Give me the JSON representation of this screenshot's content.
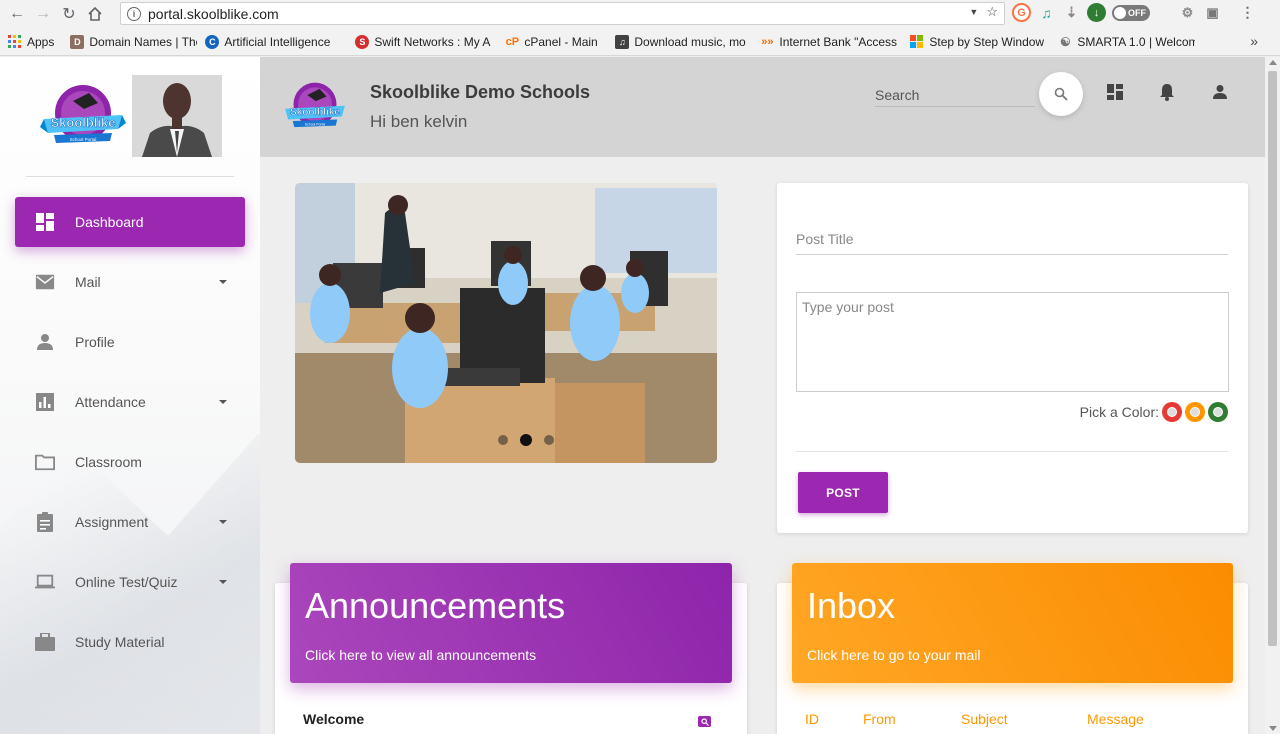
{
  "browser": {
    "url": "portal.skoolblike.com",
    "toggle_label": "OFF",
    "bookmarks": [
      {
        "label": "Apps",
        "icon": "apps-grid-icon",
        "color": "#4285f4"
      },
      {
        "label": "Domain Names | The",
        "icon": "domain-icon",
        "color": "#8d6e63"
      },
      {
        "label": "Artificial Intelligence",
        "icon": "ai-icon",
        "color": "#1565c0"
      },
      {
        "label": "Swift Networks : My A",
        "icon": "swift-icon",
        "color": "#d32f2f"
      },
      {
        "label": "cPanel - Main",
        "icon": "cpanel-icon",
        "color": "#ff6f00"
      },
      {
        "label": "Download music, mo",
        "icon": "download-music-icon",
        "color": "#424242"
      },
      {
        "label": "Internet Bank \"Access",
        "icon": "bank-icon",
        "color": "#ef6c00"
      },
      {
        "label": "Step by Step Window",
        "icon": "windows-icon",
        "color": "#43a047"
      },
      {
        "label": "SMARTA 1.0 | Welcom",
        "icon": "smarta-icon",
        "color": "#757575"
      }
    ]
  },
  "header": {
    "school_name": "Skoolblike Demo Schools",
    "greeting": "Hi ben kelvin",
    "search_placeholder": "Search"
  },
  "sidebar": {
    "logo_text": "Skoolblike",
    "logo_subtext": "School Portal",
    "items": [
      {
        "label": "Dashboard",
        "icon": "dashboard-icon",
        "active": true,
        "has_caret": false
      },
      {
        "label": "Mail",
        "icon": "mail-icon",
        "active": false,
        "has_caret": true
      },
      {
        "label": "Profile",
        "icon": "person-icon",
        "active": false,
        "has_caret": false
      },
      {
        "label": "Attendance",
        "icon": "bar-chart-icon",
        "active": false,
        "has_caret": true
      },
      {
        "label": "Classroom",
        "icon": "folder-icon",
        "active": false,
        "has_caret": false
      },
      {
        "label": "Assignment",
        "icon": "clipboard-icon",
        "active": false,
        "has_caret": true
      },
      {
        "label": "Online Test/Quiz",
        "icon": "laptop-icon",
        "active": false,
        "has_caret": true
      },
      {
        "label": "Study Material",
        "icon": "briefcase-icon",
        "active": false,
        "has_caret": false
      }
    ]
  },
  "post": {
    "title_placeholder": "Post Title",
    "body_placeholder": "Type your post",
    "pick_color_label": "Pick a Color:",
    "colors": [
      "#e53935",
      "#ff9800",
      "#2e7d32"
    ],
    "submit_label": "POST"
  },
  "announcements": {
    "title": "Announcements",
    "subtitle": "Click here to view all announcements",
    "first_item": "Welcome"
  },
  "inbox": {
    "title": "Inbox",
    "subtitle": "Click here to go to your mail",
    "columns": [
      "ID",
      "From",
      "Subject",
      "Message"
    ]
  },
  "colors": {
    "primary": "#9c27b0",
    "accent": "#ff9800"
  }
}
